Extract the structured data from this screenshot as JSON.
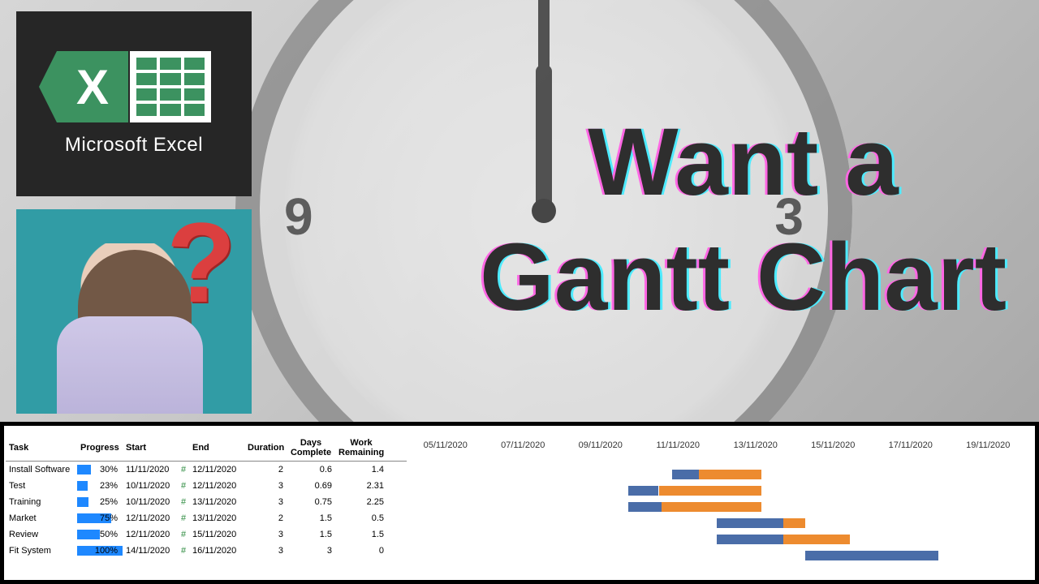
{
  "excel_label": "Microsoft Excel",
  "headline_line1": "Want a",
  "headline_line2": "Gantt Chart",
  "question_mark": "?",
  "gt_headers": {
    "task": "Task",
    "progress": "Progress",
    "start": "Start",
    "end": "End",
    "duration": "Duration",
    "days_complete": "Days Complete",
    "work_remaining": "Work Remaining"
  },
  "hash": "#",
  "axis": [
    "05/11/2020",
    "07/11/2020",
    "09/11/2020",
    "11/11/2020",
    "13/11/2020",
    "15/11/2020",
    "17/11/2020",
    "19/11/2020"
  ],
  "rows": [
    {
      "task": "Install Software",
      "progress": "30%",
      "start": "11/11/2020",
      "end": "12/11/2020",
      "duration": "2",
      "days": "0.6",
      "work": "1.4"
    },
    {
      "task": "Test",
      "progress": "23%",
      "start": "10/11/2020",
      "end": "12/11/2020",
      "duration": "3",
      "days": "0.69",
      "work": "2.31"
    },
    {
      "task": "Training",
      "progress": "25%",
      "start": "10/11/2020",
      "end": "13/11/2020",
      "duration": "3",
      "days": "0.75",
      "work": "2.25"
    },
    {
      "task": "Market",
      "progress": "75%",
      "start": "12/11/2020",
      "end": "13/11/2020",
      "duration": "2",
      "days": "1.5",
      "work": "0.5"
    },
    {
      "task": "Review",
      "progress": "50%",
      "start": "12/11/2020",
      "end": "15/11/2020",
      "duration": "3",
      "days": "1.5",
      "work": "1.5"
    },
    {
      "task": "Fit System",
      "progress": "100%",
      "start": "14/11/2020",
      "end": "16/11/2020",
      "duration": "3",
      "days": "3",
      "work": "0"
    }
  ],
  "chart_data": {
    "type": "bar",
    "title": "Task schedule Gantt",
    "x_axis_type": "date",
    "xlim": [
      "05/11/2020",
      "19/11/2020"
    ],
    "categories": [
      "Install Software",
      "Test",
      "Training",
      "Market",
      "Review",
      "Fit System"
    ],
    "series": [
      {
        "name": "Days Complete",
        "color": "#4a6da8",
        "values": [
          0.6,
          0.69,
          0.75,
          1.5,
          1.5,
          3
        ],
        "start": [
          "11/11/2020",
          "10/11/2020",
          "10/11/2020",
          "12/11/2020",
          "12/11/2020",
          "14/11/2020"
        ]
      },
      {
        "name": "Work Remaining",
        "color": "#ed8b2f",
        "values": [
          1.4,
          2.31,
          2.25,
          0.5,
          1.5,
          0
        ]
      }
    ],
    "x_ticks": [
      "05/11/2020",
      "07/11/2020",
      "09/11/2020",
      "11/11/2020",
      "13/11/2020",
      "15/11/2020",
      "17/11/2020",
      "19/11/2020"
    ]
  }
}
